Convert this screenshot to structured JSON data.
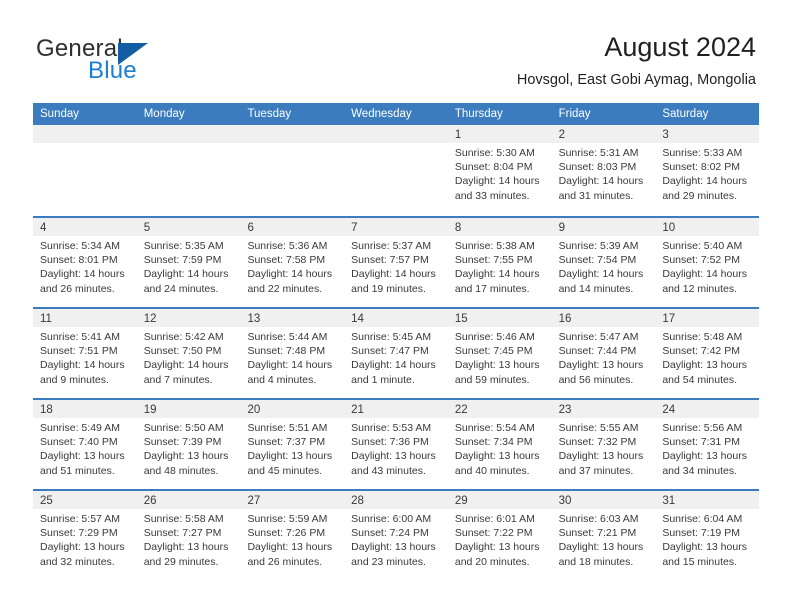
{
  "brand": {
    "name_top": "General",
    "name_bottom": "Blue",
    "accent_color": "#1b7fd4",
    "triangle_color": "#135ea3"
  },
  "header": {
    "title": "August 2024",
    "subtitle": "Hovsgol, East Gobi Aymag, Mongolia"
  },
  "calendar": {
    "header_bg": "#3b7cbf",
    "day_band_bg": "#f0f0f0",
    "weekdays": [
      "Sunday",
      "Monday",
      "Tuesday",
      "Wednesday",
      "Thursday",
      "Friday",
      "Saturday"
    ],
    "weeks": [
      [
        {
          "day": "",
          "lines": []
        },
        {
          "day": "",
          "lines": []
        },
        {
          "day": "",
          "lines": []
        },
        {
          "day": "",
          "lines": []
        },
        {
          "day": "1",
          "lines": [
            "Sunrise: 5:30 AM",
            "Sunset: 8:04 PM",
            "Daylight: 14 hours",
            "and 33 minutes."
          ]
        },
        {
          "day": "2",
          "lines": [
            "Sunrise: 5:31 AM",
            "Sunset: 8:03 PM",
            "Daylight: 14 hours",
            "and 31 minutes."
          ]
        },
        {
          "day": "3",
          "lines": [
            "Sunrise: 5:33 AM",
            "Sunset: 8:02 PM",
            "Daylight: 14 hours",
            "and 29 minutes."
          ]
        }
      ],
      [
        {
          "day": "4",
          "lines": [
            "Sunrise: 5:34 AM",
            "Sunset: 8:01 PM",
            "Daylight: 14 hours",
            "and 26 minutes."
          ]
        },
        {
          "day": "5",
          "lines": [
            "Sunrise: 5:35 AM",
            "Sunset: 7:59 PM",
            "Daylight: 14 hours",
            "and 24 minutes."
          ]
        },
        {
          "day": "6",
          "lines": [
            "Sunrise: 5:36 AM",
            "Sunset: 7:58 PM",
            "Daylight: 14 hours",
            "and 22 minutes."
          ]
        },
        {
          "day": "7",
          "lines": [
            "Sunrise: 5:37 AM",
            "Sunset: 7:57 PM",
            "Daylight: 14 hours",
            "and 19 minutes."
          ]
        },
        {
          "day": "8",
          "lines": [
            "Sunrise: 5:38 AM",
            "Sunset: 7:55 PM",
            "Daylight: 14 hours",
            "and 17 minutes."
          ]
        },
        {
          "day": "9",
          "lines": [
            "Sunrise: 5:39 AM",
            "Sunset: 7:54 PM",
            "Daylight: 14 hours",
            "and 14 minutes."
          ]
        },
        {
          "day": "10",
          "lines": [
            "Sunrise: 5:40 AM",
            "Sunset: 7:52 PM",
            "Daylight: 14 hours",
            "and 12 minutes."
          ]
        }
      ],
      [
        {
          "day": "11",
          "lines": [
            "Sunrise: 5:41 AM",
            "Sunset: 7:51 PM",
            "Daylight: 14 hours",
            "and 9 minutes."
          ]
        },
        {
          "day": "12",
          "lines": [
            "Sunrise: 5:42 AM",
            "Sunset: 7:50 PM",
            "Daylight: 14 hours",
            "and 7 minutes."
          ]
        },
        {
          "day": "13",
          "lines": [
            "Sunrise: 5:44 AM",
            "Sunset: 7:48 PM",
            "Daylight: 14 hours",
            "and 4 minutes."
          ]
        },
        {
          "day": "14",
          "lines": [
            "Sunrise: 5:45 AM",
            "Sunset: 7:47 PM",
            "Daylight: 14 hours",
            "and 1 minute."
          ]
        },
        {
          "day": "15",
          "lines": [
            "Sunrise: 5:46 AM",
            "Sunset: 7:45 PM",
            "Daylight: 13 hours",
            "and 59 minutes."
          ]
        },
        {
          "day": "16",
          "lines": [
            "Sunrise: 5:47 AM",
            "Sunset: 7:44 PM",
            "Daylight: 13 hours",
            "and 56 minutes."
          ]
        },
        {
          "day": "17",
          "lines": [
            "Sunrise: 5:48 AM",
            "Sunset: 7:42 PM",
            "Daylight: 13 hours",
            "and 54 minutes."
          ]
        }
      ],
      [
        {
          "day": "18",
          "lines": [
            "Sunrise: 5:49 AM",
            "Sunset: 7:40 PM",
            "Daylight: 13 hours",
            "and 51 minutes."
          ]
        },
        {
          "day": "19",
          "lines": [
            "Sunrise: 5:50 AM",
            "Sunset: 7:39 PM",
            "Daylight: 13 hours",
            "and 48 minutes."
          ]
        },
        {
          "day": "20",
          "lines": [
            "Sunrise: 5:51 AM",
            "Sunset: 7:37 PM",
            "Daylight: 13 hours",
            "and 45 minutes."
          ]
        },
        {
          "day": "21",
          "lines": [
            "Sunrise: 5:53 AM",
            "Sunset: 7:36 PM",
            "Daylight: 13 hours",
            "and 43 minutes."
          ]
        },
        {
          "day": "22",
          "lines": [
            "Sunrise: 5:54 AM",
            "Sunset: 7:34 PM",
            "Daylight: 13 hours",
            "and 40 minutes."
          ]
        },
        {
          "day": "23",
          "lines": [
            "Sunrise: 5:55 AM",
            "Sunset: 7:32 PM",
            "Daylight: 13 hours",
            "and 37 minutes."
          ]
        },
        {
          "day": "24",
          "lines": [
            "Sunrise: 5:56 AM",
            "Sunset: 7:31 PM",
            "Daylight: 13 hours",
            "and 34 minutes."
          ]
        }
      ],
      [
        {
          "day": "25",
          "lines": [
            "Sunrise: 5:57 AM",
            "Sunset: 7:29 PM",
            "Daylight: 13 hours",
            "and 32 minutes."
          ]
        },
        {
          "day": "26",
          "lines": [
            "Sunrise: 5:58 AM",
            "Sunset: 7:27 PM",
            "Daylight: 13 hours",
            "and 29 minutes."
          ]
        },
        {
          "day": "27",
          "lines": [
            "Sunrise: 5:59 AM",
            "Sunset: 7:26 PM",
            "Daylight: 13 hours",
            "and 26 minutes."
          ]
        },
        {
          "day": "28",
          "lines": [
            "Sunrise: 6:00 AM",
            "Sunset: 7:24 PM",
            "Daylight: 13 hours",
            "and 23 minutes."
          ]
        },
        {
          "day": "29",
          "lines": [
            "Sunrise: 6:01 AM",
            "Sunset: 7:22 PM",
            "Daylight: 13 hours",
            "and 20 minutes."
          ]
        },
        {
          "day": "30",
          "lines": [
            "Sunrise: 6:03 AM",
            "Sunset: 7:21 PM",
            "Daylight: 13 hours",
            "and 18 minutes."
          ]
        },
        {
          "day": "31",
          "lines": [
            "Sunrise: 6:04 AM",
            "Sunset: 7:19 PM",
            "Daylight: 13 hours",
            "and 15 minutes."
          ]
        }
      ]
    ]
  }
}
